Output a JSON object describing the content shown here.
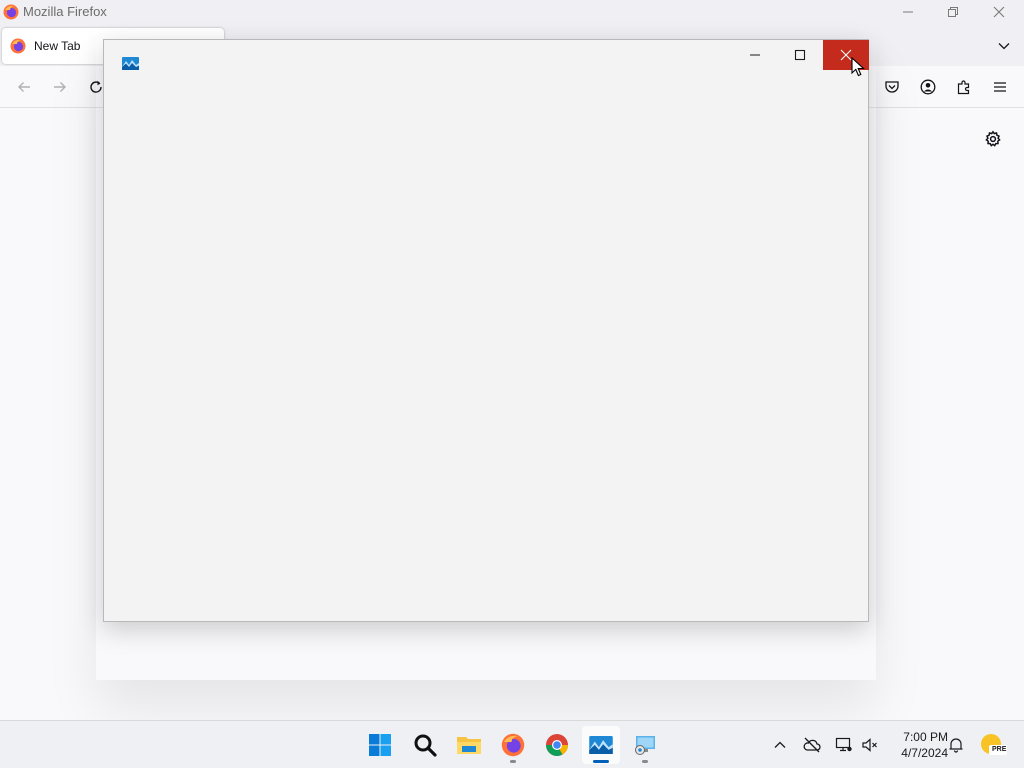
{
  "firefox": {
    "window_title": "Mozilla Firefox",
    "tab": {
      "label": "New Tab"
    },
    "icons": {
      "back": "arrow-left-icon",
      "forward": "arrow-right-icon",
      "reload": "reload-icon",
      "pocket": "pocket-icon",
      "account": "account-icon",
      "extensions": "puzzle-icon",
      "menu": "hamburger-menu-icon",
      "settings": "gear-icon",
      "tab_list": "chevron-down-icon"
    }
  },
  "popup": {
    "app_icon": "photos-app-icon",
    "controls": [
      "minimize",
      "maximize",
      "close"
    ],
    "close_color": "#c42b1c"
  },
  "taskbar": {
    "apps": [
      {
        "name": "start",
        "icon": "windows-logo-icon"
      },
      {
        "name": "search",
        "icon": "search-icon"
      },
      {
        "name": "file-explorer",
        "icon": "folder-icon"
      },
      {
        "name": "firefox",
        "icon": "firefox-icon",
        "running": true
      },
      {
        "name": "chrome",
        "icon": "chrome-icon"
      },
      {
        "name": "photos",
        "icon": "photos-app-icon",
        "running": true,
        "active": true
      },
      {
        "name": "remote-desktop",
        "icon": "remote-desktop-icon",
        "running": true
      }
    ],
    "tray": {
      "time": "7:00 PM",
      "date": "4/7/2024",
      "badge": "PRE"
    }
  }
}
